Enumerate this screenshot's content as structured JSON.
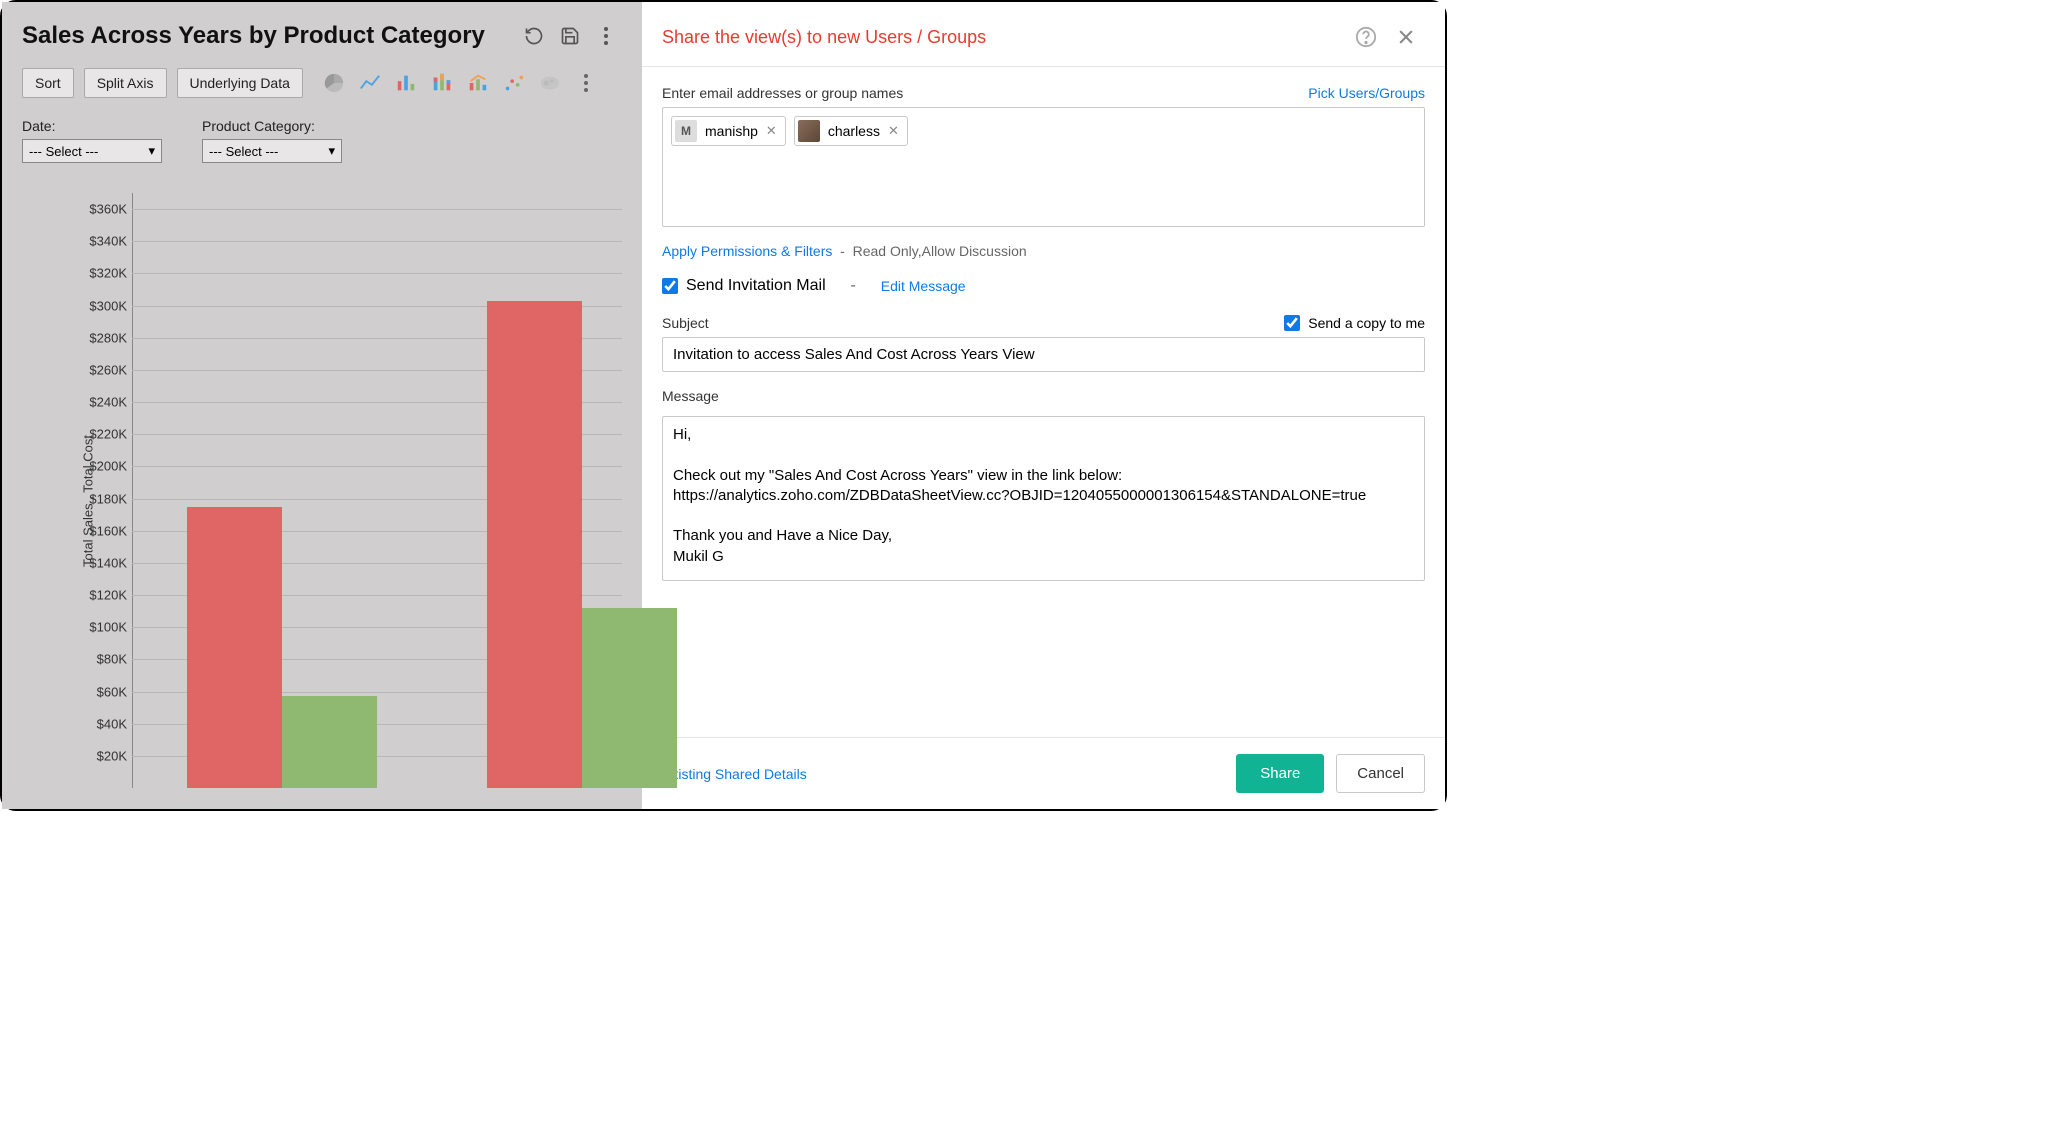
{
  "left": {
    "title": "Sales Across Years by Product Category",
    "toolbar": {
      "sort": "Sort",
      "split_axis": "Split Axis",
      "underlying": "Underlying Data"
    },
    "filters": {
      "date_label": "Date:",
      "date_value": "--- Select ---",
      "category_label": "Product Category:",
      "category_value": "--- Select ---"
    },
    "y_axis_label": "Total Sales , Total Cost"
  },
  "chart_data": {
    "type": "bar",
    "ylabel": "Total Sales , Total Cost",
    "ylim": [
      0,
      370000
    ],
    "yticks": [
      "$20K",
      "$40K",
      "$60K",
      "$80K",
      "$100K",
      "$120K",
      "$140K",
      "$160K",
      "$180K",
      "$200K",
      "$220K",
      "$240K",
      "$260K",
      "$280K",
      "$300K",
      "$320K",
      "$340K",
      "$360K"
    ],
    "ytick_values": [
      20000,
      40000,
      60000,
      80000,
      100000,
      120000,
      140000,
      160000,
      180000,
      200000,
      220000,
      240000,
      260000,
      280000,
      300000,
      320000,
      340000,
      360000
    ],
    "groups": [
      {
        "bars": [
          {
            "series": "Total Sales",
            "value": 175000,
            "color": "#e06666"
          },
          {
            "series": "Total Cost",
            "value": 57000,
            "color": "#8fb971"
          }
        ]
      },
      {
        "bars": [
          {
            "series": "Total Sales",
            "value": 303000,
            "color": "#e06666"
          },
          {
            "series": "Total Cost",
            "value": 112000,
            "color": "#8fb971"
          }
        ]
      }
    ]
  },
  "share": {
    "title": "Share the view(s) to new Users / Groups",
    "input_label": "Enter email addresses or group names",
    "pick_link": "Pick Users/Groups",
    "chips": [
      {
        "initial": "M",
        "name": "manishp",
        "photo": false
      },
      {
        "initial": "",
        "name": "charless",
        "photo": true
      }
    ],
    "perm_link": "Apply Permissions & Filters",
    "perm_sep": "-",
    "perm_desc": "Read Only,Allow Discussion",
    "send_mail_label": "Send Invitation Mail",
    "send_mail_sep": "-",
    "edit_msg": "Edit Message",
    "subject_label": "Subject",
    "copy_me_label": "Send a copy to me",
    "subject_value": "Invitation to access Sales And Cost Across Years View",
    "message_label": "Message",
    "message_value": "Hi,\n\nCheck out my \"Sales And Cost Across Years\" view in the link below:\nhttps://analytics.zoho.com/ZDBDataSheetView.cc?OBJID=1204055000001306154&STANDALONE=true\n\nThank you and Have a Nice Day,\nMukil G",
    "existing_link": "Existing Shared Details",
    "share_btn": "Share",
    "cancel_btn": "Cancel"
  }
}
